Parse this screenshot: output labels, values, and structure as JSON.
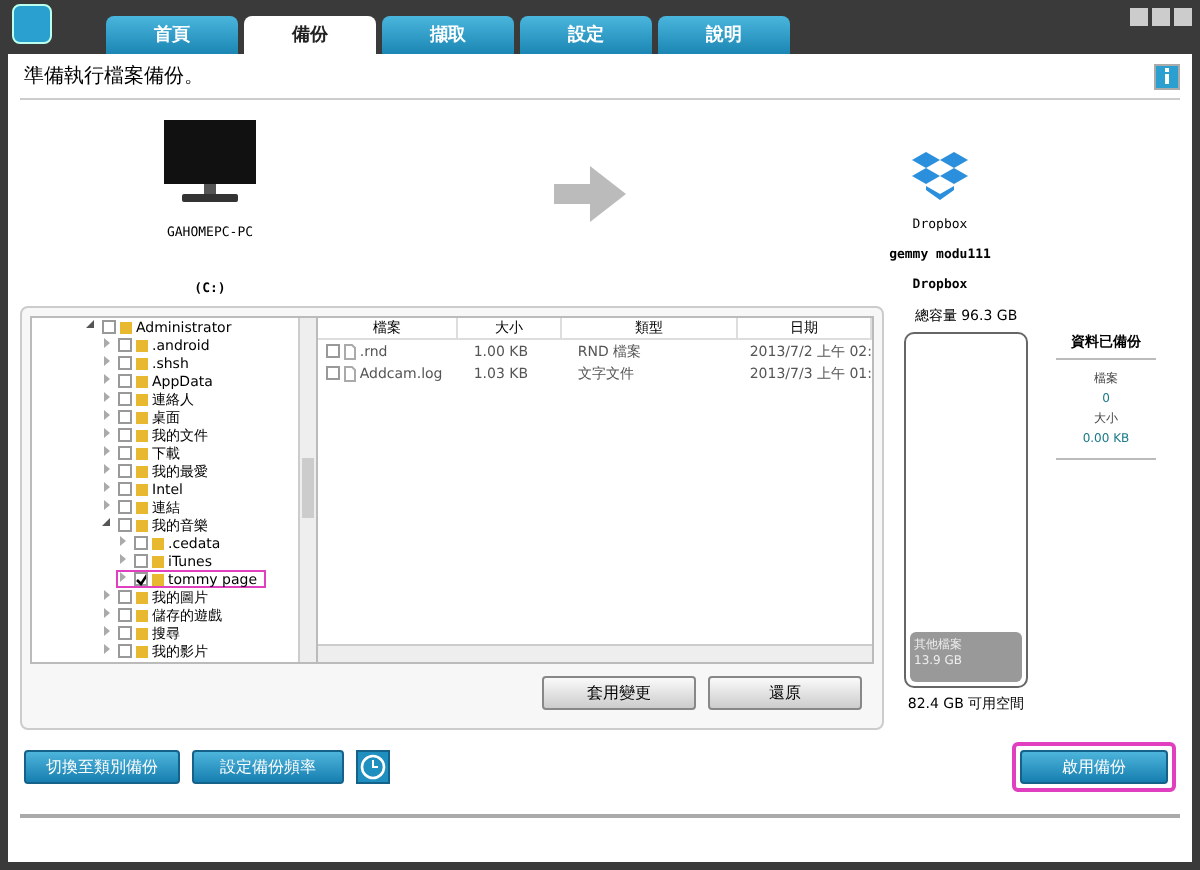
{
  "tabs": [
    {
      "label": "首頁",
      "selected": false
    },
    {
      "label": "備份",
      "selected": true
    },
    {
      "label": "擷取",
      "selected": false
    },
    {
      "label": "設定",
      "selected": false
    },
    {
      "label": "說明",
      "selected": false
    }
  ],
  "status": "準備執行檔案備份。",
  "source": {
    "name": "GAHOMEPC-PC",
    "drive": "(C:)"
  },
  "destination": {
    "service": "Dropbox",
    "account": "gemmy modu111",
    "folder": "Dropbox"
  },
  "tree": [
    {
      "label": "Administrator",
      "checked": false,
      "expanded": true,
      "highlighted": false,
      "children": [
        {
          "label": ".android",
          "checked": false,
          "expanded": false,
          "highlighted": false
        },
        {
          "label": ".shsh",
          "checked": false,
          "expanded": false,
          "highlighted": false
        },
        {
          "label": "AppData",
          "checked": false,
          "expanded": false,
          "highlighted": false
        },
        {
          "label": "連絡人",
          "checked": false,
          "expanded": false,
          "highlighted": false
        },
        {
          "label": "桌面",
          "checked": false,
          "expanded": false,
          "highlighted": false
        },
        {
          "label": "我的文件",
          "checked": false,
          "expanded": false,
          "highlighted": false
        },
        {
          "label": "下載",
          "checked": false,
          "expanded": false,
          "highlighted": false
        },
        {
          "label": "我的最愛",
          "checked": false,
          "expanded": false,
          "highlighted": false
        },
        {
          "label": "Intel",
          "checked": false,
          "expanded": false,
          "highlighted": false
        },
        {
          "label": "連結",
          "checked": false,
          "expanded": false,
          "highlighted": false
        },
        {
          "label": "我的音樂",
          "checked": false,
          "expanded": true,
          "highlighted": false,
          "children": [
            {
              "label": ".cedata",
              "checked": false,
              "expanded": false,
              "highlighted": false
            },
            {
              "label": "iTunes",
              "checked": false,
              "expanded": false,
              "highlighted": false
            },
            {
              "label": "tommy page",
              "checked": true,
              "expanded": false,
              "highlighted": true
            }
          ]
        },
        {
          "label": "我的圖片",
          "checked": false,
          "expanded": false,
          "highlighted": false
        },
        {
          "label": "儲存的遊戲",
          "checked": false,
          "expanded": false,
          "highlighted": false
        },
        {
          "label": "搜尋",
          "checked": false,
          "expanded": false,
          "highlighted": false
        },
        {
          "label": "我的影片",
          "checked": false,
          "expanded": false,
          "highlighted": false
        }
      ]
    }
  ],
  "files": {
    "columns": [
      "檔案",
      "大小",
      "類型",
      "日期"
    ],
    "rows": [
      {
        "checked": false,
        "cells": [
          ".rnd",
          "1.00 KB",
          "RND 檔案",
          "2013/7/2 上午 02:"
        ]
      },
      {
        "checked": false,
        "cells": [
          "Addcam.log",
          "1.03 KB",
          "文字文件",
          "2013/7/3 上午 01:"
        ]
      }
    ]
  },
  "pane_buttons": [
    "套用變更",
    "還原"
  ],
  "storage": {
    "total": "總容量 96.3 GB",
    "used_label": "其他檔案",
    "used_size": "13.9 GB",
    "level": 0.144,
    "free": "82.4 GB 可用空間"
  },
  "backed_up": {
    "title": "資料已備份",
    "files_label": "檔案",
    "files": "0",
    "size_label": "大小",
    "size": "0.00 KB"
  },
  "bottom_buttons": [
    "切換至類別備份",
    "設定備份頻率"
  ],
  "primary_button": {
    "label": "啟用備份",
    "highlighted": true
  }
}
